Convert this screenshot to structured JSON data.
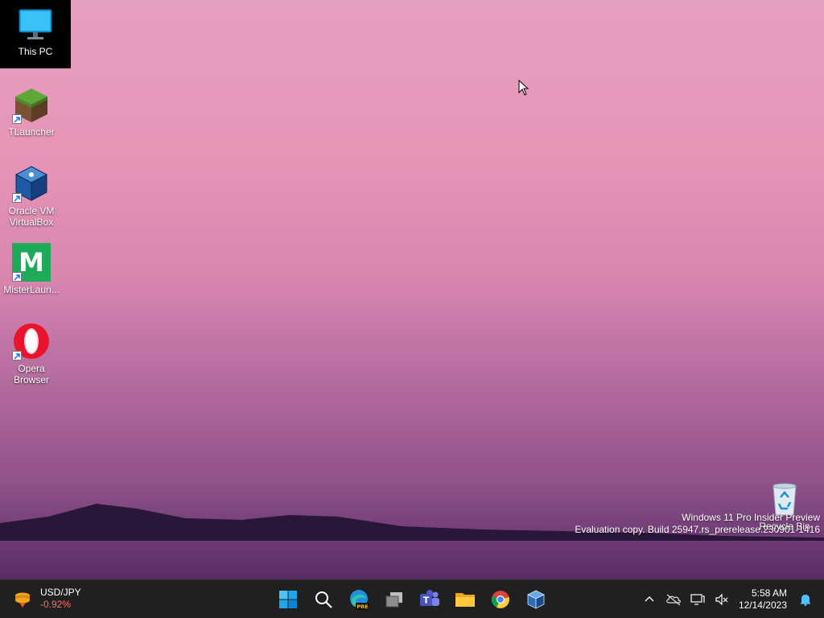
{
  "desktop": {
    "icons": [
      {
        "label": "This PC",
        "icon": "monitor-icon"
      },
      {
        "label": "TLauncher",
        "icon": "grass-block-icon"
      },
      {
        "label": "Oracle VM VirtualBox",
        "icon": "virtualbox-icon"
      },
      {
        "label": "MisterLaun...",
        "icon": "misterlauncher-icon",
        "glyph": "M"
      },
      {
        "label": "Opera Browser",
        "icon": "opera-icon"
      },
      {
        "label": "Recycle Bin",
        "icon": "recycle-bin-icon"
      }
    ],
    "watermark": {
      "line1": "Windows 11 Pro Insider Preview",
      "line2": "Evaluation copy. Build 25947.rs_prerelease.230901-1416"
    }
  },
  "taskbar": {
    "widget": {
      "pair": "USD/JPY",
      "change": "-0.92%",
      "change_color": "#ff6b6b"
    },
    "apps": [
      "start-icon",
      "search-icon",
      "edge-pre-icon",
      "task-view-icon",
      "teams-icon",
      "file-explorer-icon",
      "chrome-icon",
      "virtualbox-icon"
    ],
    "edge_badge": "PRE",
    "teams_letter": "T",
    "clock": {
      "time": "5:58 AM",
      "date": "12/14/2023"
    }
  },
  "colors": {
    "taskbar": "#202020",
    "accent": "#0078d4"
  }
}
